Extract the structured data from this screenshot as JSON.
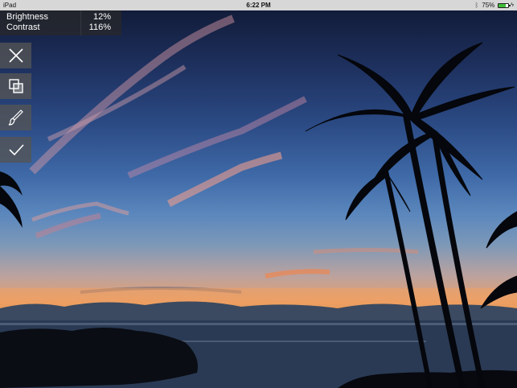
{
  "status_bar": {
    "device": "iPad",
    "time": "6:22 PM",
    "battery_percent": "75%",
    "battery_level": 0.75,
    "icons": [
      "bluetooth-icon",
      "battery-icon",
      "charging-icon"
    ]
  },
  "readout": {
    "rows": [
      {
        "label": "Brightness",
        "value": "12%"
      },
      {
        "label": "Contrast",
        "value": "116%"
      }
    ]
  },
  "toolbar": {
    "buttons": [
      {
        "name": "close",
        "icon": "close-icon"
      },
      {
        "name": "layers",
        "icon": "layers-icon"
      },
      {
        "name": "brush",
        "icon": "brush-icon"
      },
      {
        "name": "done",
        "icon": "checkmark-icon"
      }
    ]
  },
  "colors": {
    "sky_top": "#121c3a",
    "horizon": "#f29a4f",
    "toolbar_bg": "#555555",
    "battery_fill": "#3fbd3a"
  }
}
